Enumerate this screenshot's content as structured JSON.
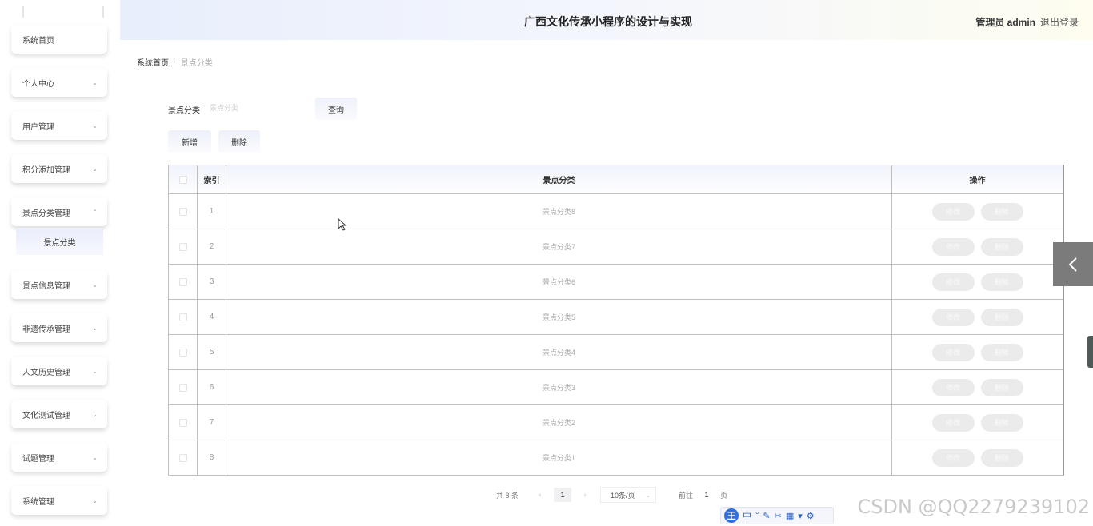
{
  "header": {
    "title": "广西文化传承小程序的设计与实现",
    "user": "管理员 admin",
    "logout": "退出登录"
  },
  "sidebar": {
    "items": [
      {
        "label": "系统首页"
      },
      {
        "label": "个人中心"
      },
      {
        "label": "用户管理"
      },
      {
        "label": "积分添加管理"
      },
      {
        "label": "景点分类管理"
      },
      {
        "label": "景点信息管理"
      },
      {
        "label": "非遗传承管理"
      },
      {
        "label": "人文历史管理"
      },
      {
        "label": "文化测试管理"
      },
      {
        "label": "试题管理"
      },
      {
        "label": "系统管理"
      }
    ],
    "submenu": {
      "label": "景点分类"
    }
  },
  "breadcrumb": {
    "home": "系统首页",
    "current": "景点分类"
  },
  "search": {
    "label": "景点分类",
    "placeholder": "景点分类",
    "query_button": "查询"
  },
  "actions": {
    "add": "新增",
    "delete": "删除"
  },
  "table": {
    "headers": {
      "index": "索引",
      "name": "景点分类",
      "ops": "操作"
    },
    "rows": [
      {
        "index": "1",
        "name": "景点分类8"
      },
      {
        "index": "2",
        "name": "景点分类7"
      },
      {
        "index": "3",
        "name": "景点分类6"
      },
      {
        "index": "4",
        "name": "景点分类5"
      },
      {
        "index": "5",
        "name": "景点分类4"
      },
      {
        "index": "6",
        "name": "景点分类3"
      },
      {
        "index": "7",
        "name": "景点分类2"
      },
      {
        "index": "8",
        "name": "景点分类1"
      }
    ],
    "edit_label": "修改",
    "delete_label": "删除"
  },
  "pagination": {
    "total": "共 8 条",
    "current_page": "1",
    "page_size": "10条/页",
    "goto_prefix": "前往",
    "goto_value": "1",
    "goto_suffix": "页"
  },
  "watermark": "CSDN @QQ2279239102",
  "ime": {
    "logo": "王",
    "mode": "中"
  }
}
